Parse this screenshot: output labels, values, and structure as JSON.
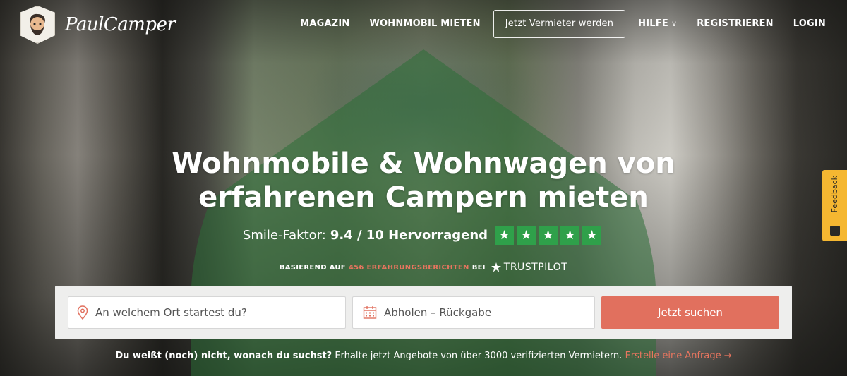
{
  "header": {
    "logo_text": "PaulCamper",
    "nav": [
      {
        "label": "MAGAZIN"
      },
      {
        "label": "WOHNMOBIL MIETEN"
      },
      {
        "label": "Jetzt Vermieter werden"
      },
      {
        "label": "HILFE"
      },
      {
        "label": "REGISTRIEREN"
      },
      {
        "label": "LOGIN"
      }
    ]
  },
  "hero": {
    "headline_line1": "Wohnmobile & Wohnwagen von",
    "headline_line2": "erfahrenen Campern mieten",
    "rating_prefix": "Smile-Faktor:",
    "rating_value": "9.4 / 10 Hervorragend",
    "stars": 5,
    "basis_prefix": "BASIEREND AUF",
    "basis_count": "456 ERFAHRUNGSBERICHTEN",
    "basis_suffix": "BEI",
    "trustpilot": "TRUSTPILOT"
  },
  "search": {
    "location_placeholder": "An welchem Ort startest du?",
    "dates_label": "Abholen – Rückgabe",
    "button_label": "Jetzt suchen"
  },
  "note": {
    "bold": "Du weißt (noch) nicht, wonach du suchst?",
    "text": " Erhalte jetzt Angebote von über 3000 verifizierten Vermietern. ",
    "link": "Erstelle eine Anfrage",
    "arrow": "→"
  },
  "feedback": {
    "label": "Feedback"
  },
  "colors": {
    "accent": "#e1705e",
    "star_green": "#2fa04a",
    "feedback_yellow": "#f5b731"
  }
}
